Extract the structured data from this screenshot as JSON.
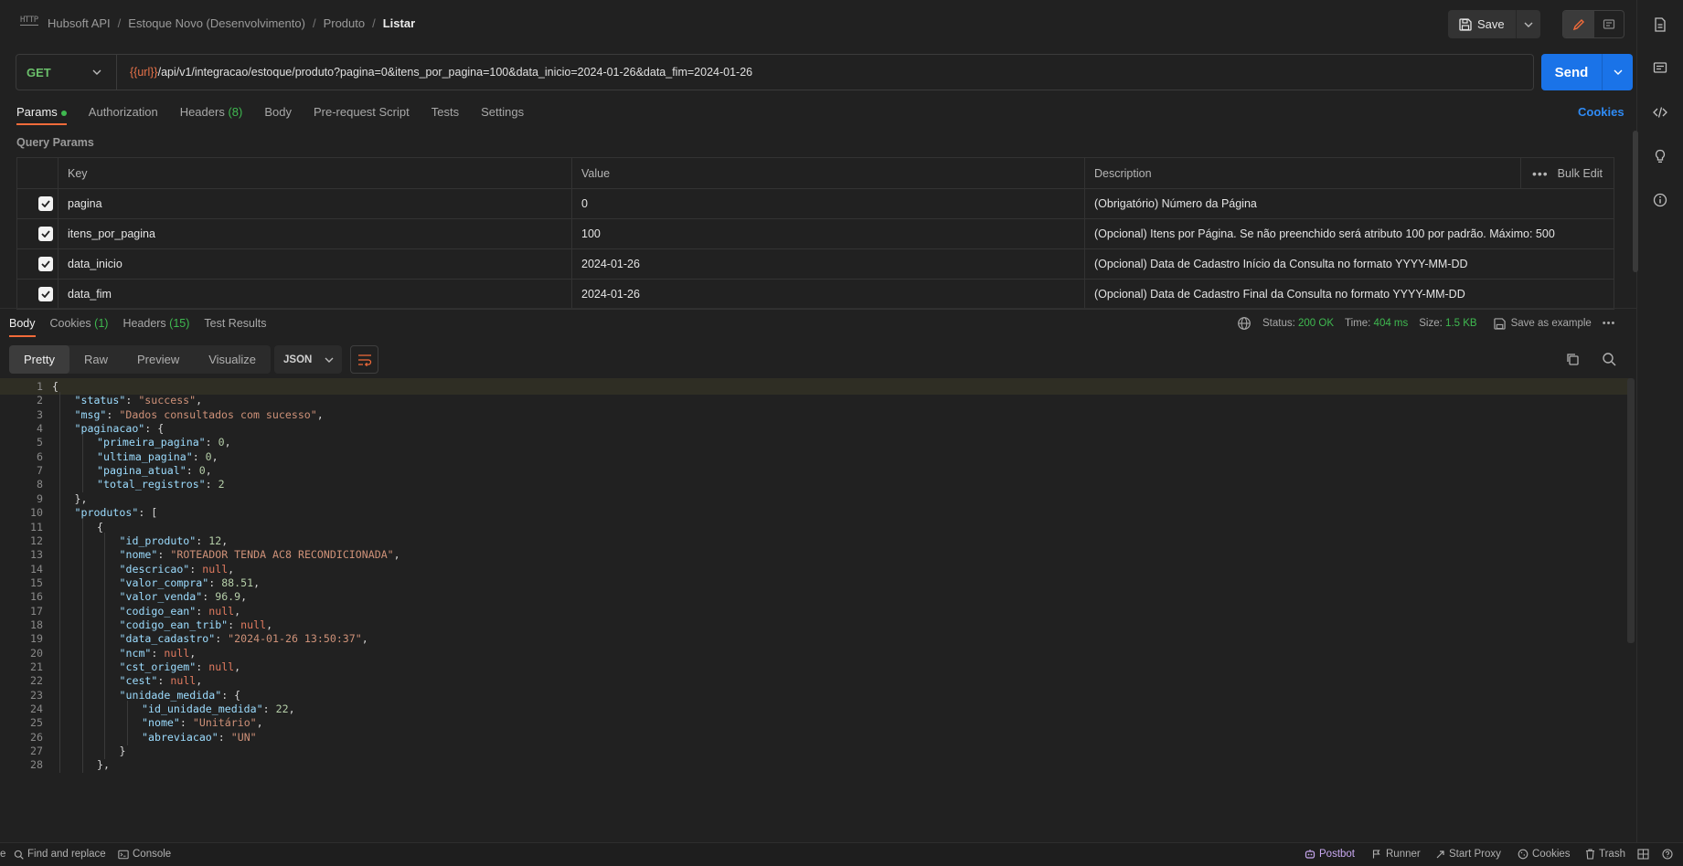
{
  "breadcrumb": {
    "icon_text": "HTTP",
    "items": [
      "Hubsoft API",
      "Estoque Novo (Desenvolvimento)",
      "Produto"
    ],
    "separator": "/",
    "current": "Listar"
  },
  "toolbar": {
    "save_label": "Save"
  },
  "request": {
    "method": "GET",
    "url_variable": "{{url}}",
    "url_path": "/api/v1/integracao/estoque/produto?pagina=0&itens_por_pagina=100&data_inicio=2024-01-26&data_fim=2024-01-26",
    "send_label": "Send"
  },
  "request_tabs": {
    "params": "Params",
    "authorization": "Authorization",
    "headers": "Headers",
    "headers_count": "(8)",
    "body": "Body",
    "pre_request": "Pre-request Script",
    "tests": "Tests",
    "settings": "Settings",
    "cookies": "Cookies"
  },
  "query_params": {
    "title": "Query Params",
    "columns": {
      "key": "Key",
      "value": "Value",
      "description": "Description"
    },
    "bulk_edit": "Bulk Edit",
    "rows": [
      {
        "key": "pagina",
        "value": "0",
        "description": "(Obrigatório) Número da Página"
      },
      {
        "key": "itens_por_pagina",
        "value": "100",
        "description": "(Opcional) Itens por Página. Se não preenchido será atributo 100 por padrão. Máximo: 500"
      },
      {
        "key": "data_inicio",
        "value": "2024-01-26",
        "description": "(Opcional) Data de Cadastro Início da Consulta no formato YYYY-MM-DD"
      },
      {
        "key": "data_fim",
        "value": "2024-01-26",
        "description": "(Opcional) Data de Cadastro Final da Consulta no formato YYYY-MM-DD"
      }
    ]
  },
  "response": {
    "tabs": {
      "body": "Body",
      "cookies": "Cookies",
      "cookies_count": "(1)",
      "headers": "Headers",
      "headers_count": "(15)",
      "test_results": "Test Results"
    },
    "meta": {
      "status_label": "Status:",
      "status_value": "200 OK",
      "time_label": "Time:",
      "time_value": "404 ms",
      "size_label": "Size:",
      "size_value": "1.5 KB",
      "save_example": "Save as example"
    },
    "view_modes": [
      "Pretty",
      "Raw",
      "Preview",
      "Visualize"
    ],
    "format": "JSON"
  },
  "code_lines": [
    {
      "n": "1",
      "indent": 0,
      "tokens": [
        [
          "p",
          "{"
        ]
      ]
    },
    {
      "n": "2",
      "indent": 1,
      "tokens": [
        [
          "k",
          "\"status\""
        ],
        [
          "p",
          ": "
        ],
        [
          "s",
          "\"success\""
        ],
        [
          "p",
          ","
        ]
      ]
    },
    {
      "n": "3",
      "indent": 1,
      "tokens": [
        [
          "k",
          "\"msg\""
        ],
        [
          "p",
          ": "
        ],
        [
          "s",
          "\"Dados consultados com sucesso\""
        ],
        [
          "p",
          ","
        ]
      ]
    },
    {
      "n": "4",
      "indent": 1,
      "tokens": [
        [
          "k",
          "\"paginacao\""
        ],
        [
          "p",
          ": {"
        ]
      ]
    },
    {
      "n": "5",
      "indent": 2,
      "tokens": [
        [
          "k",
          "\"primeira_pagina\""
        ],
        [
          "p",
          ": "
        ],
        [
          "n",
          "0"
        ],
        [
          "p",
          ","
        ]
      ]
    },
    {
      "n": "6",
      "indent": 2,
      "tokens": [
        [
          "k",
          "\"ultima_pagina\""
        ],
        [
          "p",
          ": "
        ],
        [
          "n",
          "0"
        ],
        [
          "p",
          ","
        ]
      ]
    },
    {
      "n": "7",
      "indent": 2,
      "tokens": [
        [
          "k",
          "\"pagina_atual\""
        ],
        [
          "p",
          ": "
        ],
        [
          "n",
          "0"
        ],
        [
          "p",
          ","
        ]
      ]
    },
    {
      "n": "8",
      "indent": 2,
      "tokens": [
        [
          "k",
          "\"total_registros\""
        ],
        [
          "p",
          ": "
        ],
        [
          "n",
          "2"
        ]
      ]
    },
    {
      "n": "9",
      "indent": 1,
      "tokens": [
        [
          "p",
          "},"
        ]
      ]
    },
    {
      "n": "10",
      "indent": 1,
      "tokens": [
        [
          "k",
          "\"produtos\""
        ],
        [
          "p",
          ": ["
        ]
      ]
    },
    {
      "n": "11",
      "indent": 2,
      "tokens": [
        [
          "p",
          "{"
        ]
      ]
    },
    {
      "n": "12",
      "indent": 3,
      "tokens": [
        [
          "k",
          "\"id_produto\""
        ],
        [
          "p",
          ": "
        ],
        [
          "n",
          "12"
        ],
        [
          "p",
          ","
        ]
      ]
    },
    {
      "n": "13",
      "indent": 3,
      "tokens": [
        [
          "k",
          "\"nome\""
        ],
        [
          "p",
          ": "
        ],
        [
          "s",
          "\"ROTEADOR TENDA AC8 RECONDICIONADA\""
        ],
        [
          "p",
          ","
        ]
      ]
    },
    {
      "n": "14",
      "indent": 3,
      "tokens": [
        [
          "k",
          "\"descricao\""
        ],
        [
          "p",
          ": "
        ],
        [
          "x",
          "null"
        ],
        [
          "p",
          ","
        ]
      ]
    },
    {
      "n": "15",
      "indent": 3,
      "tokens": [
        [
          "k",
          "\"valor_compra\""
        ],
        [
          "p",
          ": "
        ],
        [
          "n",
          "88.51"
        ],
        [
          "p",
          ","
        ]
      ]
    },
    {
      "n": "16",
      "indent": 3,
      "tokens": [
        [
          "k",
          "\"valor_venda\""
        ],
        [
          "p",
          ": "
        ],
        [
          "n",
          "96.9"
        ],
        [
          "p",
          ","
        ]
      ]
    },
    {
      "n": "17",
      "indent": 3,
      "tokens": [
        [
          "k",
          "\"codigo_ean\""
        ],
        [
          "p",
          ": "
        ],
        [
          "x",
          "null"
        ],
        [
          "p",
          ","
        ]
      ]
    },
    {
      "n": "18",
      "indent": 3,
      "tokens": [
        [
          "k",
          "\"codigo_ean_trib\""
        ],
        [
          "p",
          ": "
        ],
        [
          "x",
          "null"
        ],
        [
          "p",
          ","
        ]
      ]
    },
    {
      "n": "19",
      "indent": 3,
      "tokens": [
        [
          "k",
          "\"data_cadastro\""
        ],
        [
          "p",
          ": "
        ],
        [
          "s",
          "\"2024-01-26 13:50:37\""
        ],
        [
          "p",
          ","
        ]
      ]
    },
    {
      "n": "20",
      "indent": 3,
      "tokens": [
        [
          "k",
          "\"ncm\""
        ],
        [
          "p",
          ": "
        ],
        [
          "x",
          "null"
        ],
        [
          "p",
          ","
        ]
      ]
    },
    {
      "n": "21",
      "indent": 3,
      "tokens": [
        [
          "k",
          "\"cst_origem\""
        ],
        [
          "p",
          ": "
        ],
        [
          "x",
          "null"
        ],
        [
          "p",
          ","
        ]
      ]
    },
    {
      "n": "22",
      "indent": 3,
      "tokens": [
        [
          "k",
          "\"cest\""
        ],
        [
          "p",
          ": "
        ],
        [
          "x",
          "null"
        ],
        [
          "p",
          ","
        ]
      ]
    },
    {
      "n": "23",
      "indent": 3,
      "tokens": [
        [
          "k",
          "\"unidade_medida\""
        ],
        [
          "p",
          ": {"
        ]
      ]
    },
    {
      "n": "24",
      "indent": 4,
      "tokens": [
        [
          "k",
          "\"id_unidade_medida\""
        ],
        [
          "p",
          ": "
        ],
        [
          "n",
          "22"
        ],
        [
          "p",
          ","
        ]
      ]
    },
    {
      "n": "25",
      "indent": 4,
      "tokens": [
        [
          "k",
          "\"nome\""
        ],
        [
          "p",
          ": "
        ],
        [
          "s",
          "\"Unitário\""
        ],
        [
          "p",
          ","
        ]
      ]
    },
    {
      "n": "26",
      "indent": 4,
      "tokens": [
        [
          "k",
          "\"abreviacao\""
        ],
        [
          "p",
          ": "
        ],
        [
          "s",
          "\"UN\""
        ]
      ]
    },
    {
      "n": "27",
      "indent": 3,
      "tokens": [
        [
          "p",
          "}"
        ]
      ]
    },
    {
      "n": "28",
      "indent": 2,
      "tokens": [
        [
          "p",
          "},"
        ]
      ]
    }
  ],
  "status_bar": {
    "edge_char": "e",
    "find_replace": "Find and replace",
    "console": "Console",
    "postbot": "Postbot",
    "runner": "Runner",
    "start_proxy": "Start Proxy",
    "cookies": "Cookies",
    "trash": "Trash"
  },
  "colors": {
    "accent_orange": "#f26b3a",
    "send_blue": "#1a73e8",
    "method_green": "#6bbf6b",
    "status_green": "#3fb950",
    "cookies_blue": "#2f8bf5"
  },
  "icons": {
    "rail": [
      "document-icon",
      "comment-icon",
      "code-icon",
      "lightbulb-icon",
      "info-icon"
    ]
  }
}
